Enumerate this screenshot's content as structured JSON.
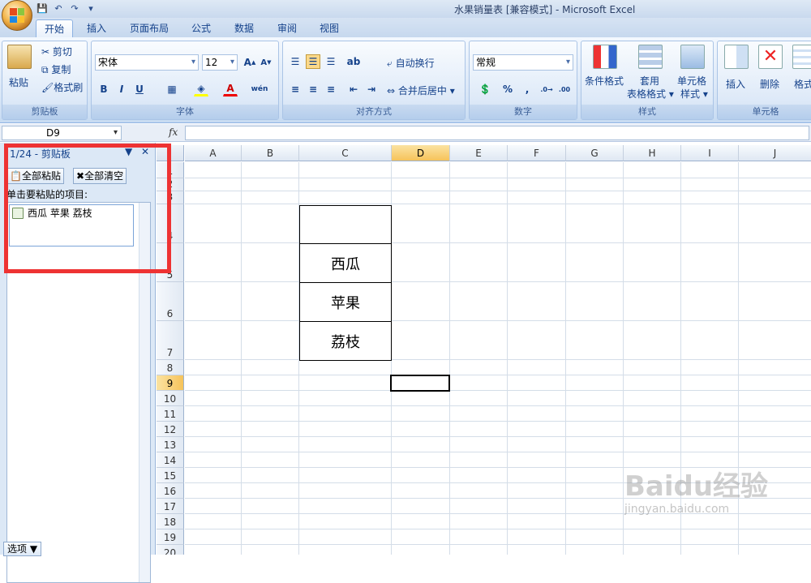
{
  "window": {
    "title": "水果销量表 [兼容模式] - Microsoft Excel"
  },
  "tabs": [
    "开始",
    "插入",
    "页面布局",
    "公式",
    "数据",
    "审阅",
    "视图"
  ],
  "ribbon": {
    "clipboard": {
      "paste": "粘贴",
      "cut": "剪切",
      "copy": "复制",
      "format_painter": "格式刷",
      "group": "剪贴板"
    },
    "font": {
      "name": "宋体",
      "size": "12",
      "group": "字体",
      "bold": "B",
      "italic": "I",
      "underline": "U"
    },
    "alignment": {
      "wrap": "自动换行",
      "merge": "合并后居中",
      "group": "对齐方式"
    },
    "number": {
      "format": "常规",
      "percent": "%",
      "comma": ",",
      "group": "数字"
    },
    "styles": {
      "conditional": "条件格式",
      "table_format_1": "套用",
      "table_format_2": "表格格式",
      "cell_styles_1": "单元格",
      "cell_styles_2": "样式",
      "group": "样式"
    },
    "cells": {
      "insert": "插入",
      "delete": "删除",
      "format": "格式",
      "group": "单元格"
    }
  },
  "formula_bar": {
    "name_box": "D9",
    "fx": "fx",
    "value": ""
  },
  "task_pane": {
    "title": "1/24 - 剪贴板",
    "paste_all": "全部粘贴",
    "clear_all": "全部清空",
    "hint": "单击要粘贴的项目:",
    "items": [
      {
        "text": "西瓜 苹果 荔枝"
      }
    ],
    "options": "选项 ▼"
  },
  "sheet": {
    "columns": [
      "A",
      "B",
      "C",
      "D",
      "E",
      "F",
      "G",
      "H",
      "I",
      "J"
    ],
    "selected_column": "D",
    "selected_row": "9",
    "rows": [
      "1",
      "2",
      "3",
      "4",
      "5",
      "6",
      "7",
      "8",
      "9",
      "10",
      "11",
      "12",
      "13",
      "14",
      "15",
      "16",
      "17",
      "18",
      "19",
      "20"
    ],
    "cells": {
      "C5": "西瓜",
      "C6": "苹果",
      "C7": "荔枝"
    }
  },
  "watermark": {
    "main": "Baidu经验",
    "sub": "jingyan.baidu.com"
  }
}
